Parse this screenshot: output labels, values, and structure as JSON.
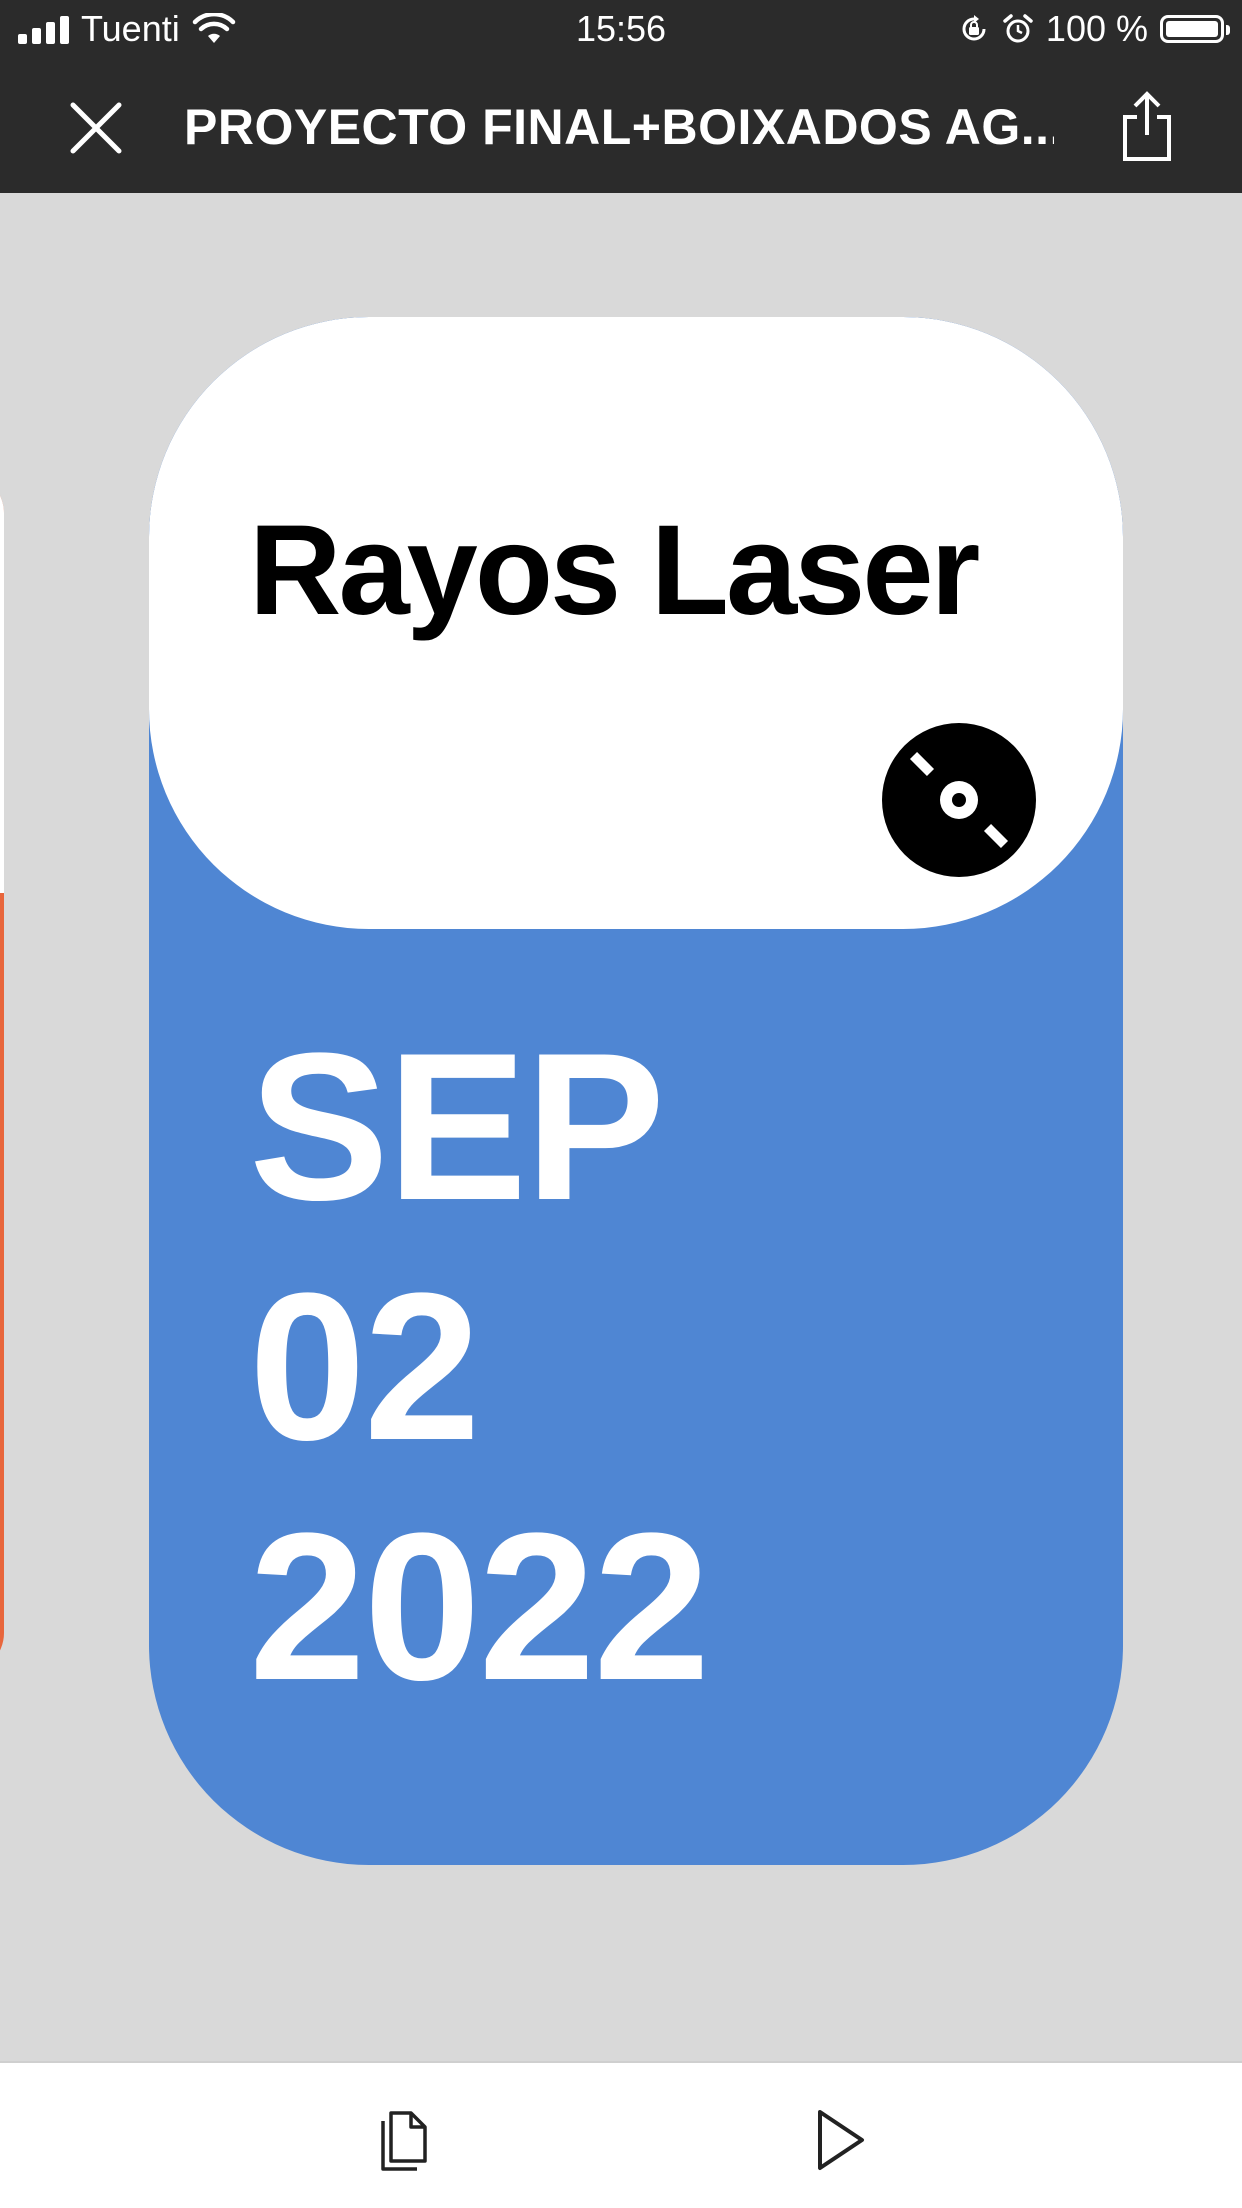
{
  "status_bar": {
    "carrier": "Tuenti",
    "time": "15:56",
    "battery_percent": "100 %",
    "battery_level": 1.0,
    "icons": [
      "signal-icon",
      "wifi-icon",
      "orientation-lock-icon",
      "alarm-icon",
      "battery-icon"
    ]
  },
  "header": {
    "title": "PROYECTO FINAL+BOIXADOS AG...",
    "close_icon": "close-icon",
    "share_icon": "share-icon"
  },
  "card": {
    "event_name": "Rayos Laser",
    "month": "SEP",
    "day": "02",
    "year": "2022",
    "icon": "vinyl-record-icon",
    "colors": {
      "header": "#ffffff",
      "body": "#4f86d3",
      "previous_card_accent": "#e8663c"
    }
  },
  "toolbar": {
    "pages_icon": "pages-icon",
    "play_icon": "play-icon"
  },
  "colors": {
    "topbar": "#2b2b2b",
    "canvas": "#d9d9d9",
    "bottombar": "#ffffff"
  }
}
